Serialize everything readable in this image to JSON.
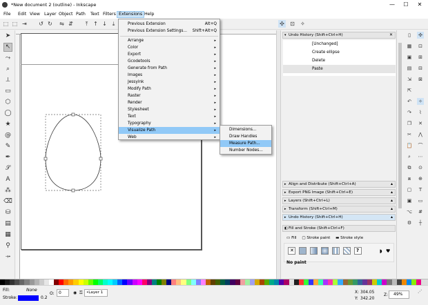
{
  "window": {
    "title": "*New document 2 (outline) - Inkscape",
    "minimize": "—",
    "maximize": "☐",
    "close": "✕"
  },
  "menubar": {
    "items": [
      "File",
      "Edit",
      "View",
      "Layer",
      "Object",
      "Path",
      "Text",
      "Filters",
      "Extensions",
      "Help"
    ],
    "active": "Extensions"
  },
  "extensions_menu": {
    "items": [
      {
        "label": "Previous Extension",
        "shortcut": "Alt+Q"
      },
      {
        "label": "Previous Extension Settings...",
        "shortcut": "Shift+Alt+Q"
      },
      {
        "label": "Arrange"
      },
      {
        "label": "Color"
      },
      {
        "label": "Export"
      },
      {
        "label": "Gcodetools"
      },
      {
        "label": "Generate from Path"
      },
      {
        "label": "Images"
      },
      {
        "label": "Jessyink"
      },
      {
        "label": "Modify Path"
      },
      {
        "label": "Raster"
      },
      {
        "label": "Render"
      },
      {
        "label": "Stylesheet"
      },
      {
        "label": "Text"
      },
      {
        "label": "Typography"
      },
      {
        "label": "Visualize Path"
      },
      {
        "label": "Web"
      }
    ],
    "submenu_arrow": "▸",
    "highlighted": "Visualize Path"
  },
  "visualize_submenu": {
    "items": [
      "Dimensions...",
      "Draw Handles",
      "Measure Path...",
      "Number Nodes..."
    ],
    "highlighted": "Measure Path..."
  },
  "undo_history": {
    "title": "Undo History (Shift+Ctrl+H)",
    "rows": [
      "[Unchanged]",
      "Create ellipse",
      "Delete",
      "Paste"
    ],
    "selected": "Paste"
  },
  "collapsed_panels": [
    "Align and Distribute (Shift+Ctrl+A)",
    "Export PNG Image (Shift+Ctrl+E)",
    "Layers (Shift+Ctrl+L)",
    "Transform (Shift+Ctrl+M)",
    "Undo History (Shift+Ctrl+H)"
  ],
  "fill_stroke": {
    "title": "Fill and Stroke (Shift+Ctrl+F)",
    "tabs": [
      "Fill",
      "Stroke paint",
      "Stroke style"
    ],
    "status": "No paint",
    "unset_glyph": "?"
  },
  "statusbar": {
    "fill_label": "Fill:",
    "fill_value": "None",
    "stroke_label": "Stroke:",
    "stroke_width": "0.2",
    "opacity_label": "O:",
    "opacity_value": "0",
    "layer": "•Layer 1",
    "x_label": "X:",
    "x_value": "304.05",
    "y_label": "Y:",
    "y_value": "342.20",
    "zoom_label": "Z:",
    "zoom_value": "49%"
  },
  "colors": {
    "accent": "#91c9f7",
    "menu_open": "#cce4f7",
    "stroke_swatch": "#0000ff"
  },
  "palette": [
    "#000000",
    "#1a1a1a",
    "#333333",
    "#4d4d4d",
    "#666666",
    "#808080",
    "#999999",
    "#b3b3b3",
    "#cccccc",
    "#e6e6e6",
    "#ffffff",
    "#800000",
    "#ff0000",
    "#ff6600",
    "#ff9900",
    "#ffcc00",
    "#ffff00",
    "#ccff00",
    "#66ff00",
    "#00ff00",
    "#00ff66",
    "#00ffcc",
    "#00ffff",
    "#00ccff",
    "#0066ff",
    "#0000ff",
    "#6600ff",
    "#cc00ff",
    "#ff00ff",
    "#ff0066",
    "#800080",
    "#008080",
    "#008000",
    "#808000",
    "#000080",
    "#ff8080",
    "#ffc080",
    "#ffff80",
    "#80ff80",
    "#80ffff",
    "#8080ff",
    "#ff80ff",
    "#c06000",
    "#604000",
    "#406000",
    "#006040",
    "#004060",
    "#400060",
    "#600040",
    "#f0a0a0",
    "#a0f0a0",
    "#a0a0f0",
    "#d4aa00",
    "#aa4400",
    "#55aa00",
    "#00aa88",
    "#0088aa",
    "#5500aa",
    "#aa0066",
    "#e0e0e0",
    "#202020",
    "#ff3333",
    "#33ff33",
    "#3333ff",
    "#ffaa33",
    "#33ffaa",
    "#aa33ff",
    "#ff33aa",
    "#aaff33",
    "#33aaff",
    "#996633",
    "#669933",
    "#339966",
    "#336699",
    "#663399",
    "#993366",
    "#cccc00",
    "#00cccc",
    "#cc00cc",
    "#777777",
    "#bbbbbb",
    "#444444",
    "#ee8800",
    "#0088ee",
    "#88ee00",
    "#ee0088"
  ]
}
